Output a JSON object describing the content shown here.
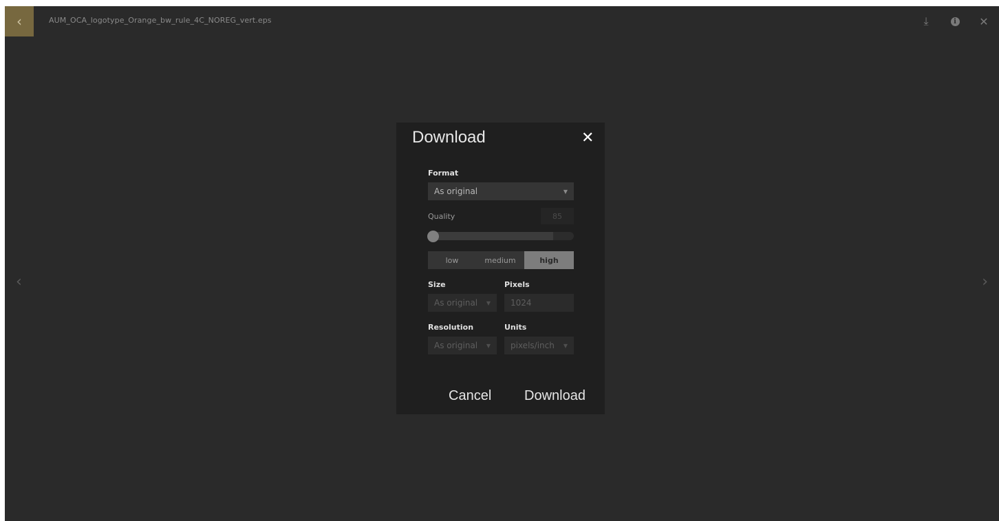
{
  "viewer": {
    "file_name": "AUM_OCA_logotype_Orange_bw_rule_4C_NOREG_vert.eps",
    "back_glyph": "‹",
    "download_glyph": "⤓",
    "info_glyph": "i",
    "close_glyph": "✕",
    "prev_glyph": "‹",
    "next_glyph": "›",
    "accent_color": "#77683f"
  },
  "dialog": {
    "title": "Download",
    "close_glyph": "✕",
    "format": {
      "label": "Format",
      "value": "As original"
    },
    "quality": {
      "label": "Quality",
      "value": "85",
      "slider_level": 0.86,
      "options": [
        "low",
        "medium",
        "high"
      ],
      "selected": "high"
    },
    "size": {
      "label": "Size",
      "value": "As original"
    },
    "pixels": {
      "label": "Pixels",
      "value": "1024"
    },
    "resolution": {
      "label": "Resolution",
      "value": "As original"
    },
    "units": {
      "label": "Units",
      "value": "pixels/inch"
    },
    "cancel_label": "Cancel",
    "download_label": "Download"
  }
}
